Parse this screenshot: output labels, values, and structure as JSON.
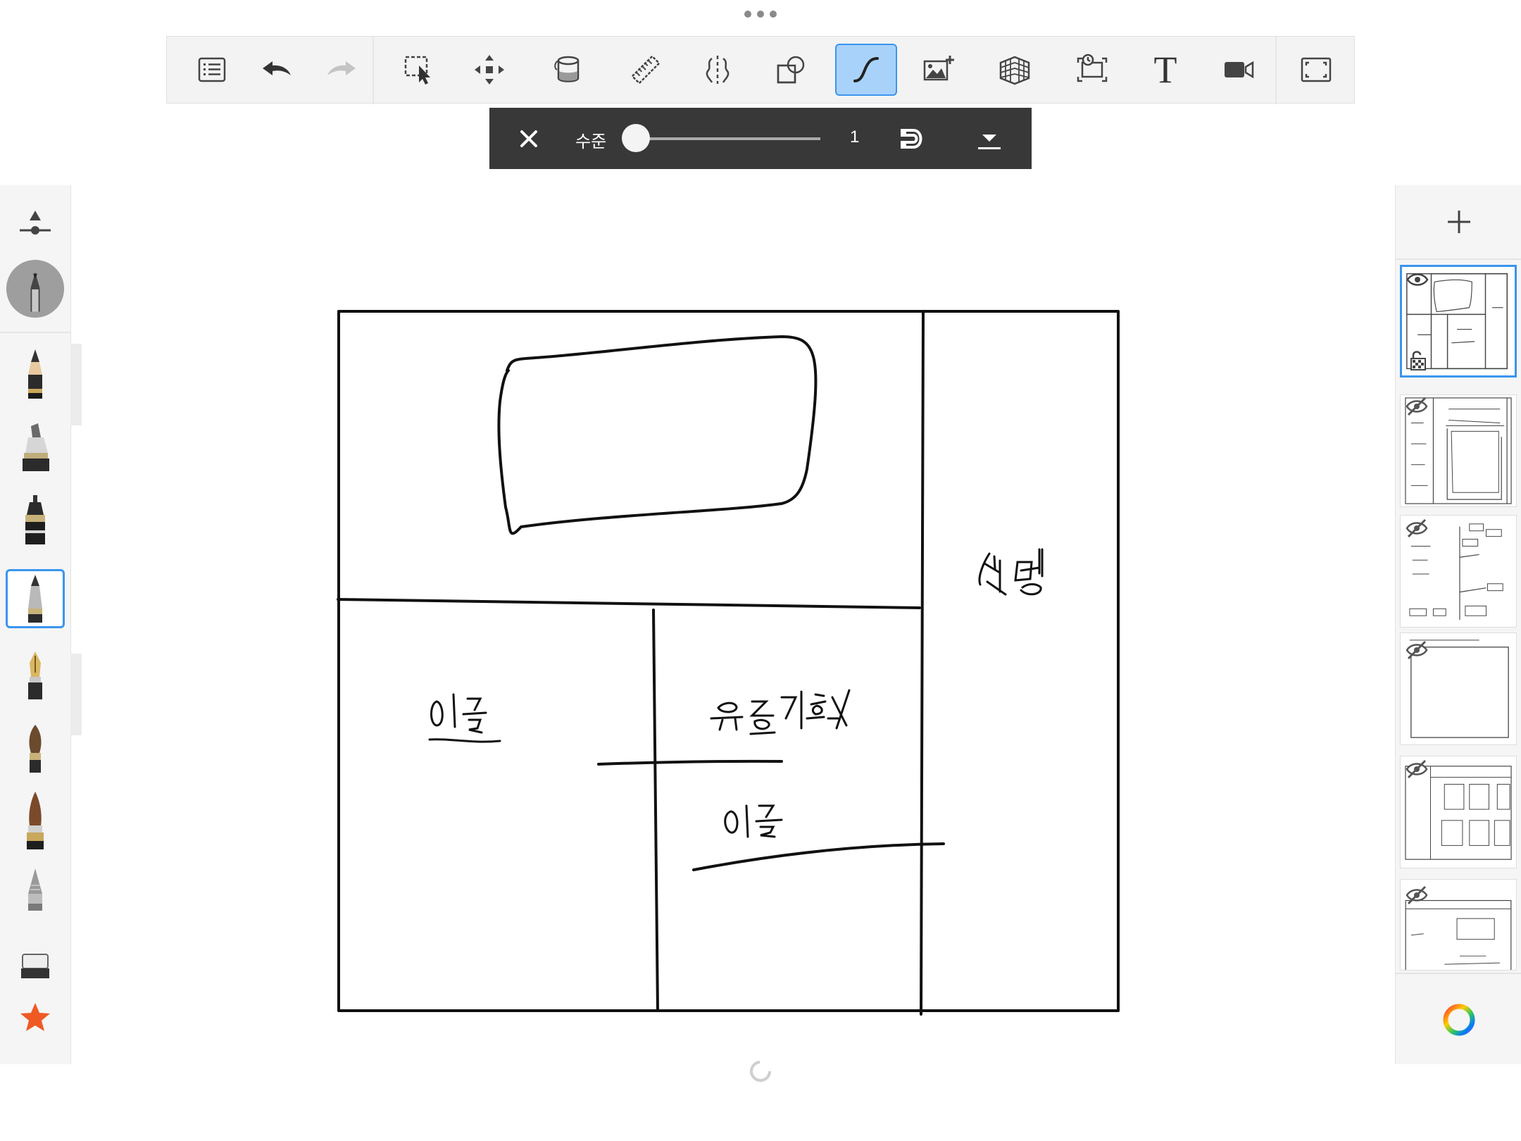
{
  "toolbar": {
    "tools": [
      {
        "name": "layers-list",
        "icon": "list-icon"
      },
      {
        "name": "undo",
        "icon": "undo-icon"
      },
      {
        "name": "redo",
        "icon": "redo-icon"
      },
      {
        "name": "select",
        "icon": "selection-icon"
      },
      {
        "name": "transform",
        "icon": "move-icon"
      },
      {
        "name": "fill",
        "icon": "paint-bucket-icon"
      },
      {
        "name": "ruler",
        "icon": "ruler-icon"
      },
      {
        "name": "symmetry",
        "icon": "symmetry-icon"
      },
      {
        "name": "shapes",
        "icon": "shapes-icon"
      },
      {
        "name": "predictive-stroke",
        "icon": "stroke-icon",
        "active": true
      },
      {
        "name": "import-image",
        "icon": "image-add-icon"
      },
      {
        "name": "perspective",
        "icon": "perspective-grid-icon"
      },
      {
        "name": "time-lapse",
        "icon": "timelapse-icon"
      },
      {
        "name": "text",
        "icon": "text-icon",
        "label": "T"
      },
      {
        "name": "record",
        "icon": "video-icon"
      },
      {
        "name": "fullscreen",
        "icon": "fullscreen-icon"
      }
    ]
  },
  "stroke_options": {
    "level_label": "수준",
    "level_value": "1",
    "level_fraction": 0.0
  },
  "brushes": {
    "items": [
      "opacity-slider",
      "current-brush",
      "pencil",
      "marker",
      "ink-pen",
      "ballpoint",
      "fountain-pen",
      "round-brush",
      "paint-brush",
      "airbrush",
      "eraser",
      "favorites"
    ],
    "active": "ballpoint"
  },
  "layers": {
    "add_label": "+",
    "count": 6,
    "active_index": 0
  },
  "colors": {
    "accent": "#3a95ee",
    "active_bg": "#a9d2fb",
    "subbar": "#383838",
    "panel": "#f5f5f5",
    "ink": "#111111",
    "favorite": "#ef5a24"
  },
  "sketch": {
    "labels": [
      "설명",
      "이름",
      "유통기한X",
      "이름"
    ]
  }
}
